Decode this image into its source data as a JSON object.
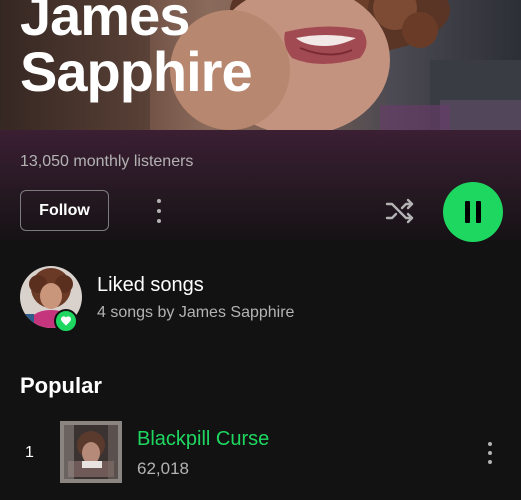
{
  "artist": {
    "name_line1": "James",
    "name_line2": "Sapphire",
    "monthly_listeners": "13,050 monthly listeners"
  },
  "actions": {
    "follow_label": "Follow",
    "more_icon": "more-vertical-icon",
    "shuffle_icon": "shuffle-icon",
    "play_state_icon": "pause-icon"
  },
  "liked_songs": {
    "title": "Liked songs",
    "subtitle": "4 songs by James Sapphire",
    "badge_icon": "heart-icon"
  },
  "popular": {
    "heading": "Popular",
    "tracks": [
      {
        "rank": "1",
        "title": "Blackpill Curse",
        "plays": "62,018",
        "playing": true
      }
    ]
  },
  "colors": {
    "accent_green": "#1ed760",
    "background": "#121212",
    "secondary_text": "#b3b3b3",
    "band_top": "#3b1f33"
  }
}
